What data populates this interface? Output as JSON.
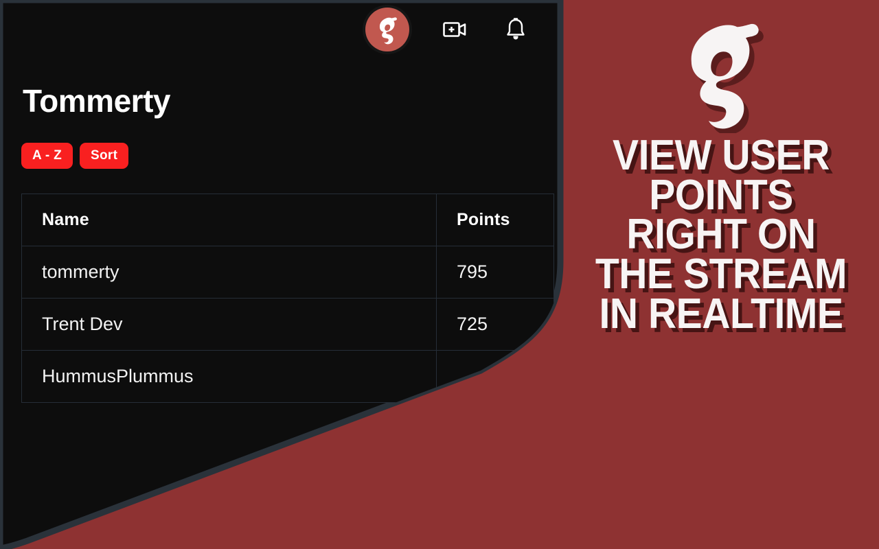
{
  "app": {
    "panel_bg": "#0D0D0D",
    "accent_red": "#F92020",
    "brand_red": "#8E3232",
    "avatar_red": "#C1584F",
    "border": "#262E38"
  },
  "topbar": {
    "avatar": {
      "name": "user-avatar",
      "logo_letter": "g"
    },
    "icons": [
      {
        "name": "go-live-icon",
        "label": "Go Live"
      },
      {
        "name": "notifications-bell-icon",
        "label": "Notifications"
      }
    ]
  },
  "page": {
    "title": "Tommerty"
  },
  "filters": {
    "buttons": [
      {
        "name": "sort-alpha-button",
        "label": "A - Z"
      },
      {
        "name": "sort-button",
        "label": "Sort"
      }
    ]
  },
  "table": {
    "columns": [
      "Name",
      "Points"
    ],
    "rows": [
      {
        "name": "tommerty",
        "points": "795"
      },
      {
        "name": "Trent Dev",
        "points": "725"
      },
      {
        "name": "HummusPlummus",
        "points": ""
      }
    ]
  },
  "promo": {
    "logo_letter": "g",
    "lines": [
      "VIEW USER",
      "POINTS",
      "RIGHT ON",
      "THE STREAM",
      "IN REALTIME"
    ]
  }
}
